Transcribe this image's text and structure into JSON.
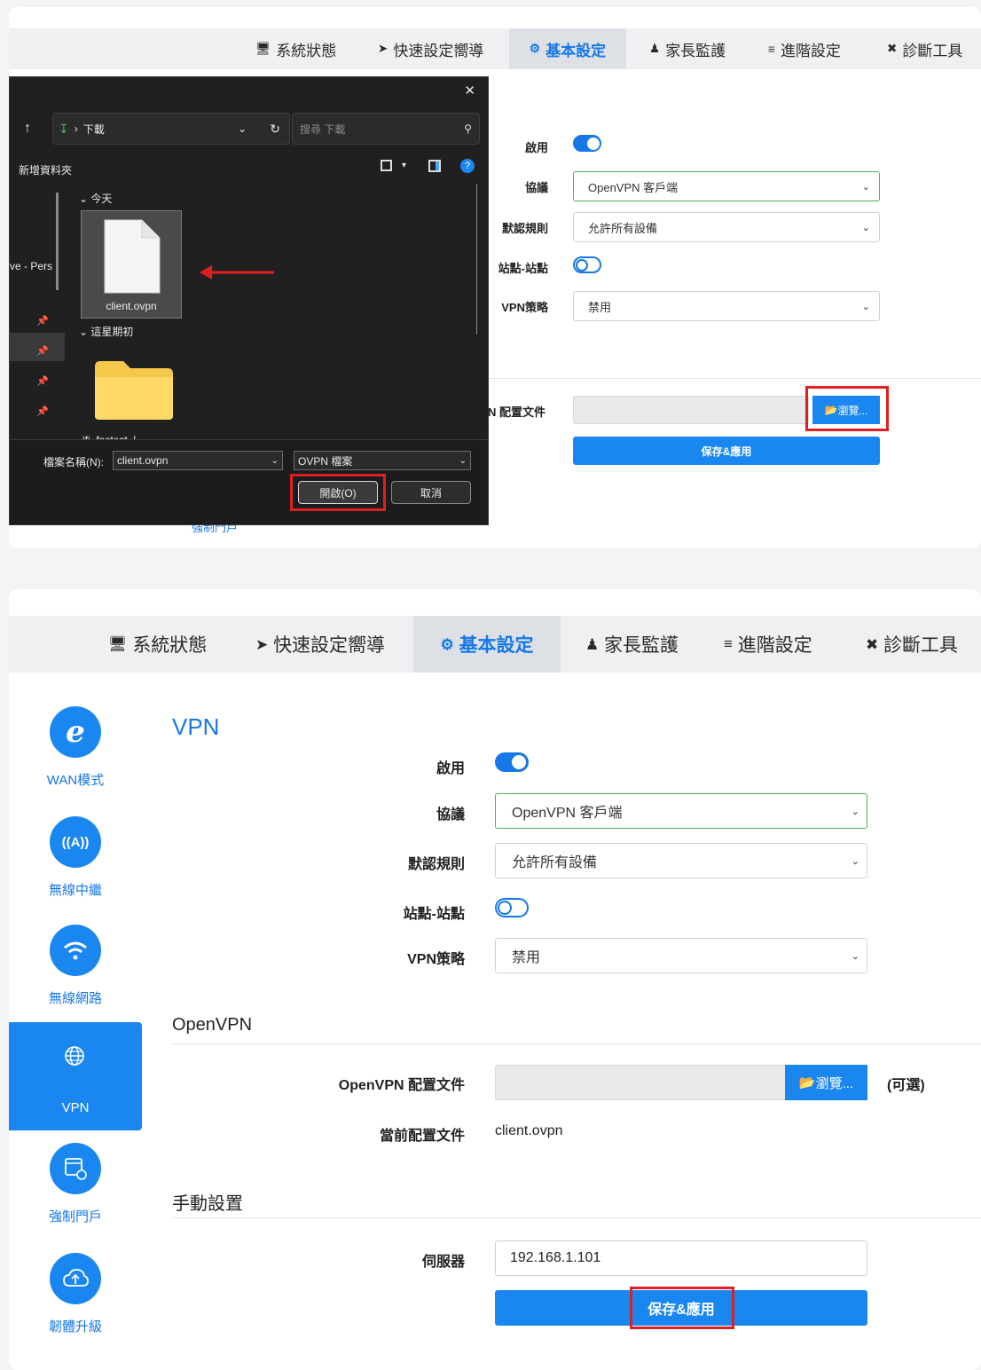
{
  "nav": {
    "items": [
      {
        "label": "系統狀態",
        "icon": "monitor-icon"
      },
      {
        "label": "快速設定嚮導",
        "icon": "rocket-icon"
      },
      {
        "label": "基本設定",
        "icon": "gear-icon"
      },
      {
        "label": "家長監護",
        "icon": "family-icon"
      },
      {
        "label": "進階設定",
        "icon": "sliders-icon"
      },
      {
        "label": "診斷工具",
        "icon": "tools-icon"
      }
    ]
  },
  "form": {
    "enable_label": "啟用",
    "protocol_label": "協議",
    "protocol_value": "OpenVPN 客戶端",
    "default_rule_label": "默認規則",
    "default_rule_value": "允許所有設備",
    "site_to_site_label": "站點-站點",
    "vpn_policy_label": "VPN策略",
    "vpn_policy_value": "禁用",
    "config_file_label": "OpenVPN 配置文件",
    "config_file_label_clipped": "N 配置文件",
    "browse_label": "瀏覽...",
    "optional_label": "(可選)",
    "current_config_label": "當前配置文件",
    "current_config_value": "client.ovpn",
    "server_label": "伺服器",
    "server_value": "192.168.1.101",
    "save_label": "保存&應用"
  },
  "sections": {
    "vpn": "VPN",
    "openvpn": "OpenVPN",
    "manual": "手動設置"
  },
  "sidebar": {
    "items": [
      {
        "label": "WAN模式",
        "icon": "ie-icon",
        "glyph": "e"
      },
      {
        "label": "無線中繼",
        "icon": "repeater-icon",
        "glyph": "((A))"
      },
      {
        "label": "無線網路",
        "icon": "wifi-icon",
        "glyph": ""
      },
      {
        "label": "VPN",
        "icon": "globe-icon",
        "glyph": ""
      },
      {
        "label": "強制門戶",
        "icon": "portal-icon",
        "glyph": ""
      },
      {
        "label": "韌體升級",
        "icon": "cloud-upload-icon",
        "glyph": ""
      }
    ],
    "partial_label": "強制門戶"
  },
  "dialog": {
    "path": "下載",
    "search_placeholder": "搜尋 下載",
    "new_folder": "新增資料夾",
    "group_today": "今天",
    "group_week": "這星期初",
    "file_name": "client.ovpn",
    "left_pane_text": "ve - Pers",
    "filename_label": "檔案名稱(N):",
    "filename_value": "client.ovpn",
    "filetype_value": "OVPN 檔案",
    "open_label": "開啟(O)",
    "cancel_label": "取消",
    "folder_partial": "ifi_fastest_l"
  },
  "colors": {
    "accent": "#1a87f0",
    "highlight": "#e02020",
    "arrow": "#e02020"
  }
}
